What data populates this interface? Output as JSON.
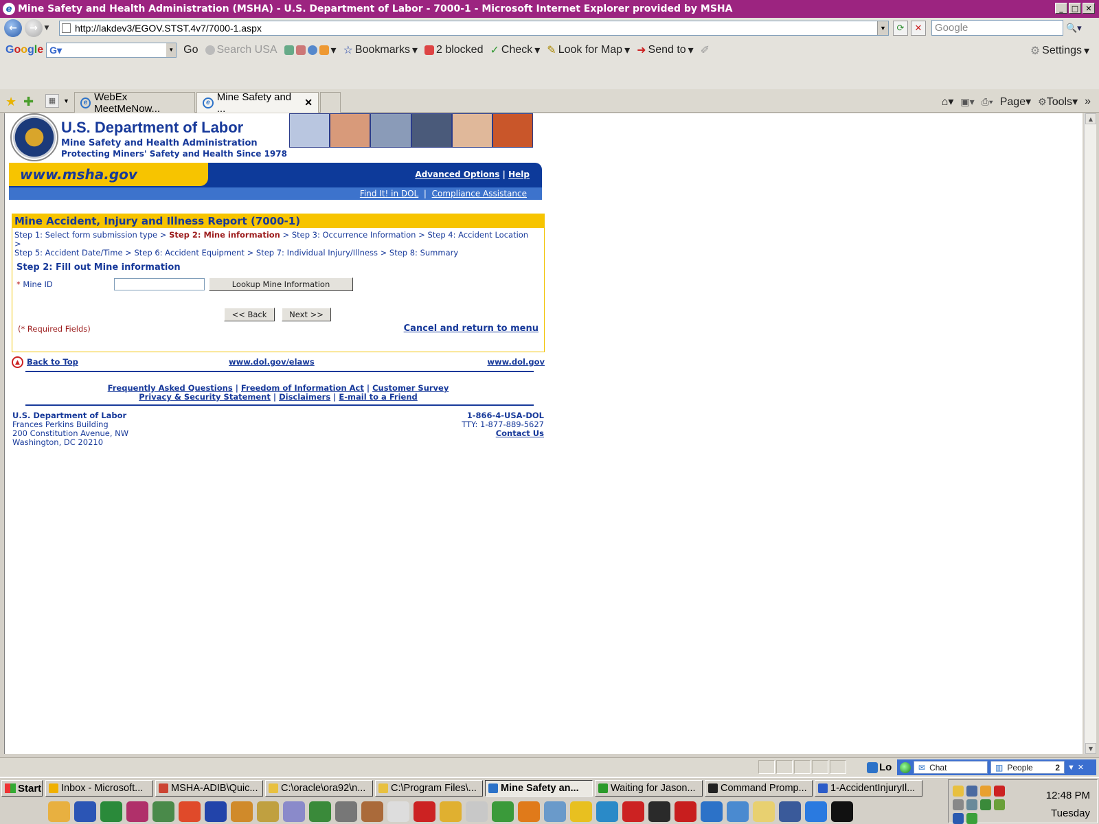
{
  "window": {
    "title": "Mine Safety and Health Administration (MSHA) - U.S. Department of Labor - 7000-1 - Microsoft Internet Explorer provided by MSHA",
    "controls": [
      "_",
      "□",
      "✕"
    ]
  },
  "address_bar": {
    "url": "http://lakdev3/EGOV.STST.4v7/7000-1.aspx",
    "search_placeholder": "Google"
  },
  "google_toolbar": {
    "go_label": "Go",
    "search_usa": "Search USA",
    "bookmarks": "Bookmarks",
    "blocked": "2 blocked",
    "check": "Check",
    "look_for_map": "Look for Map",
    "send_to": "Send to",
    "settings": "Settings"
  },
  "tabs": [
    {
      "label": "WebEx MeetMeNow..."
    },
    {
      "label": "Mine Safety and ...",
      "active": true
    }
  ],
  "command_bar": {
    "page": "Page",
    "tools": "Tools"
  },
  "page": {
    "header": {
      "title": "U.S. Department of Labor",
      "subtitle1": "Mine Safety and Health Administration",
      "subtitle2": "Protecting Miners' Safety and Health Since 1978",
      "site": "www.msha.gov",
      "advanced_options": "Advanced Options",
      "help": "Help",
      "find_it": "Find It! in DOL",
      "compliance": "Compliance Assistance"
    },
    "form": {
      "heading": "Mine Accident, Injury and Illness Report (7000-1)",
      "steps": [
        "Step 1: Select form submission type",
        "Step 2: Mine information",
        "Step 3: Occurrence Information",
        "Step 4: Accident Location",
        "Step 5: Accident Date/Time",
        "Step 6: Accident Equipment",
        "Step 7: Individual Injury/Illness",
        "Step 8: Summary"
      ],
      "step_title": "Step 2: Fill out Mine information",
      "mine_id_label": "Mine ID",
      "required_star": "*",
      "mine_id_value": "",
      "lookup_button": "Lookup Mine Information",
      "back_button": "<< Back",
      "next_button": "Next >>",
      "required_note": "(* Required Fields)",
      "cancel_link": "Cancel and return to menu"
    },
    "footer": {
      "back_to_top": "Back to Top",
      "elaws": "www.dol.gov/elaws",
      "dol": "www.dol.gov",
      "faq": "Frequently Asked Questions",
      "foia": "Freedom of Information Act",
      "survey": "Customer Survey",
      "privacy": "Privacy & Security Statement",
      "disclaimers": "Disclaimers",
      "email_friend": "E-mail to a Friend",
      "org": "U.S. Department of Labor",
      "building": "Frances Perkins Building",
      "street": "200 Constitution Avenue, NW",
      "city": "Washington, DC 20210",
      "phone": "1-866-4-USA-DOL",
      "tty": "TTY: 1-877-889-5627",
      "contact": "Contact Us"
    }
  },
  "status_bar": {
    "lo_text": "Lo",
    "chat": "Chat",
    "people": "People",
    "people_count": "2"
  },
  "taskbar": {
    "start": "Start",
    "tasks": [
      {
        "label": "Inbox - Microsoft...",
        "color": "#f0b000"
      },
      {
        "label": "MSHA-ADIB\\Quic...",
        "color": "#c43"
      },
      {
        "label": "C:\\oracle\\ora92\\n...",
        "color": "#e8c040"
      },
      {
        "label": "C:\\Program Files\\...",
        "color": "#e8c040"
      },
      {
        "label": "Mine Safety an...",
        "color": "#2c72c8",
        "active": true
      },
      {
        "label": "Waiting for Jason...",
        "color": "#2a9a2a"
      },
      {
        "label": "Command Promp...",
        "color": "#222"
      },
      {
        "label": "1-AccidentInjuryIl...",
        "color": "#2c5cc8"
      }
    ],
    "clock_time": "12:48 PM",
    "clock_day": "Tuesday"
  },
  "colors": {
    "title_bar": "#9c2480",
    "dol_blue": "#17399a",
    "msha_yellow": "#f7c400",
    "required_red": "#9c1c1c"
  }
}
